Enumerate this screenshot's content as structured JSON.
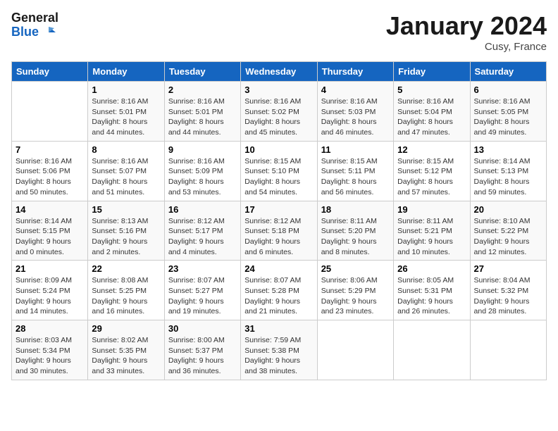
{
  "header": {
    "logo_line1": "General",
    "logo_line2": "Blue",
    "month": "January 2024",
    "location": "Cusy, France"
  },
  "days_of_week": [
    "Sunday",
    "Monday",
    "Tuesday",
    "Wednesday",
    "Thursday",
    "Friday",
    "Saturday"
  ],
  "weeks": [
    [
      {
        "num": "",
        "sunrise": "",
        "sunset": "",
        "daylight": ""
      },
      {
        "num": "1",
        "sunrise": "Sunrise: 8:16 AM",
        "sunset": "Sunset: 5:01 PM",
        "daylight": "Daylight: 8 hours and 44 minutes."
      },
      {
        "num": "2",
        "sunrise": "Sunrise: 8:16 AM",
        "sunset": "Sunset: 5:01 PM",
        "daylight": "Daylight: 8 hours and 44 minutes."
      },
      {
        "num": "3",
        "sunrise": "Sunrise: 8:16 AM",
        "sunset": "Sunset: 5:02 PM",
        "daylight": "Daylight: 8 hours and 45 minutes."
      },
      {
        "num": "4",
        "sunrise": "Sunrise: 8:16 AM",
        "sunset": "Sunset: 5:03 PM",
        "daylight": "Daylight: 8 hours and 46 minutes."
      },
      {
        "num": "5",
        "sunrise": "Sunrise: 8:16 AM",
        "sunset": "Sunset: 5:04 PM",
        "daylight": "Daylight: 8 hours and 47 minutes."
      },
      {
        "num": "6",
        "sunrise": "Sunrise: 8:16 AM",
        "sunset": "Sunset: 5:05 PM",
        "daylight": "Daylight: 8 hours and 49 minutes."
      }
    ],
    [
      {
        "num": "7",
        "sunrise": "Sunrise: 8:16 AM",
        "sunset": "Sunset: 5:06 PM",
        "daylight": "Daylight: 8 hours and 50 minutes."
      },
      {
        "num": "8",
        "sunrise": "Sunrise: 8:16 AM",
        "sunset": "Sunset: 5:07 PM",
        "daylight": "Daylight: 8 hours and 51 minutes."
      },
      {
        "num": "9",
        "sunrise": "Sunrise: 8:16 AM",
        "sunset": "Sunset: 5:09 PM",
        "daylight": "Daylight: 8 hours and 53 minutes."
      },
      {
        "num": "10",
        "sunrise": "Sunrise: 8:15 AM",
        "sunset": "Sunset: 5:10 PM",
        "daylight": "Daylight: 8 hours and 54 minutes."
      },
      {
        "num": "11",
        "sunrise": "Sunrise: 8:15 AM",
        "sunset": "Sunset: 5:11 PM",
        "daylight": "Daylight: 8 hours and 56 minutes."
      },
      {
        "num": "12",
        "sunrise": "Sunrise: 8:15 AM",
        "sunset": "Sunset: 5:12 PM",
        "daylight": "Daylight: 8 hours and 57 minutes."
      },
      {
        "num": "13",
        "sunrise": "Sunrise: 8:14 AM",
        "sunset": "Sunset: 5:13 PM",
        "daylight": "Daylight: 8 hours and 59 minutes."
      }
    ],
    [
      {
        "num": "14",
        "sunrise": "Sunrise: 8:14 AM",
        "sunset": "Sunset: 5:15 PM",
        "daylight": "Daylight: 9 hours and 0 minutes."
      },
      {
        "num": "15",
        "sunrise": "Sunrise: 8:13 AM",
        "sunset": "Sunset: 5:16 PM",
        "daylight": "Daylight: 9 hours and 2 minutes."
      },
      {
        "num": "16",
        "sunrise": "Sunrise: 8:12 AM",
        "sunset": "Sunset: 5:17 PM",
        "daylight": "Daylight: 9 hours and 4 minutes."
      },
      {
        "num": "17",
        "sunrise": "Sunrise: 8:12 AM",
        "sunset": "Sunset: 5:18 PM",
        "daylight": "Daylight: 9 hours and 6 minutes."
      },
      {
        "num": "18",
        "sunrise": "Sunrise: 8:11 AM",
        "sunset": "Sunset: 5:20 PM",
        "daylight": "Daylight: 9 hours and 8 minutes."
      },
      {
        "num": "19",
        "sunrise": "Sunrise: 8:11 AM",
        "sunset": "Sunset: 5:21 PM",
        "daylight": "Daylight: 9 hours and 10 minutes."
      },
      {
        "num": "20",
        "sunrise": "Sunrise: 8:10 AM",
        "sunset": "Sunset: 5:22 PM",
        "daylight": "Daylight: 9 hours and 12 minutes."
      }
    ],
    [
      {
        "num": "21",
        "sunrise": "Sunrise: 8:09 AM",
        "sunset": "Sunset: 5:24 PM",
        "daylight": "Daylight: 9 hours and 14 minutes."
      },
      {
        "num": "22",
        "sunrise": "Sunrise: 8:08 AM",
        "sunset": "Sunset: 5:25 PM",
        "daylight": "Daylight: 9 hours and 16 minutes."
      },
      {
        "num": "23",
        "sunrise": "Sunrise: 8:07 AM",
        "sunset": "Sunset: 5:27 PM",
        "daylight": "Daylight: 9 hours and 19 minutes."
      },
      {
        "num": "24",
        "sunrise": "Sunrise: 8:07 AM",
        "sunset": "Sunset: 5:28 PM",
        "daylight": "Daylight: 9 hours and 21 minutes."
      },
      {
        "num": "25",
        "sunrise": "Sunrise: 8:06 AM",
        "sunset": "Sunset: 5:29 PM",
        "daylight": "Daylight: 9 hours and 23 minutes."
      },
      {
        "num": "26",
        "sunrise": "Sunrise: 8:05 AM",
        "sunset": "Sunset: 5:31 PM",
        "daylight": "Daylight: 9 hours and 26 minutes."
      },
      {
        "num": "27",
        "sunrise": "Sunrise: 8:04 AM",
        "sunset": "Sunset: 5:32 PM",
        "daylight": "Daylight: 9 hours and 28 minutes."
      }
    ],
    [
      {
        "num": "28",
        "sunrise": "Sunrise: 8:03 AM",
        "sunset": "Sunset: 5:34 PM",
        "daylight": "Daylight: 9 hours and 30 minutes."
      },
      {
        "num": "29",
        "sunrise": "Sunrise: 8:02 AM",
        "sunset": "Sunset: 5:35 PM",
        "daylight": "Daylight: 9 hours and 33 minutes."
      },
      {
        "num": "30",
        "sunrise": "Sunrise: 8:00 AM",
        "sunset": "Sunset: 5:37 PM",
        "daylight": "Daylight: 9 hours and 36 minutes."
      },
      {
        "num": "31",
        "sunrise": "Sunrise: 7:59 AM",
        "sunset": "Sunset: 5:38 PM",
        "daylight": "Daylight: 9 hours and 38 minutes."
      },
      {
        "num": "",
        "sunrise": "",
        "sunset": "",
        "daylight": ""
      },
      {
        "num": "",
        "sunrise": "",
        "sunset": "",
        "daylight": ""
      },
      {
        "num": "",
        "sunrise": "",
        "sunset": "",
        "daylight": ""
      }
    ]
  ]
}
